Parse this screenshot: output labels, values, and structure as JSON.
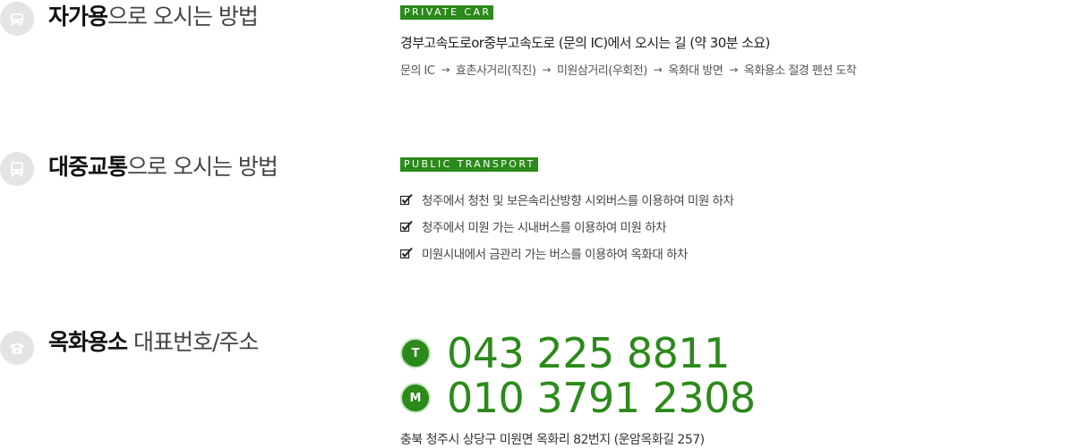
{
  "car": {
    "heading_strong": "자가용",
    "heading_rest": "으로 오시는 방법",
    "tag": "PRIVATE CAR",
    "route_title": "경부고속도로or중부고속도로 (문의 IC)에서 오시는 길 (약 30분 소요)",
    "route_steps": [
      "문의 IC",
      "효촌사거리(직진)",
      "미원삼거리(우회전)",
      "옥화대 방면",
      "옥화용소 절경 펜션 도착"
    ],
    "arrow": "→",
    "icon": "car-icon"
  },
  "bus": {
    "heading_strong": "대중교통",
    "heading_rest": "으로 오시는 방법",
    "tag": "PUBLIC TRANSPORT",
    "items": [
      "청주에서 청천 및 보은속리산방향 시외버스를 이용하여 미원 하차",
      "청주에서 미원 가는 시내버스를 이용하여 미원 하차",
      "미원시내에서 금관리 가는 버스를 이용하여 옥화대 하차"
    ],
    "icon": "bus-icon",
    "check_icon": "checkmark-icon"
  },
  "contact": {
    "heading_strong": "옥화용소",
    "heading_rest": " 대표번호/주소",
    "phone_label": "T",
    "phone": "043 225 8811",
    "mobile_label": "M",
    "mobile": "010 3791 2308",
    "address": "충북 청주시 상당구 미원면 옥화리 82번지 (운암옥화길 257)",
    "icon": "telephone-icon"
  },
  "colors": {
    "accent": "#2b8a1a",
    "icon_bg": "#e4e4e4",
    "text": "#333333"
  }
}
